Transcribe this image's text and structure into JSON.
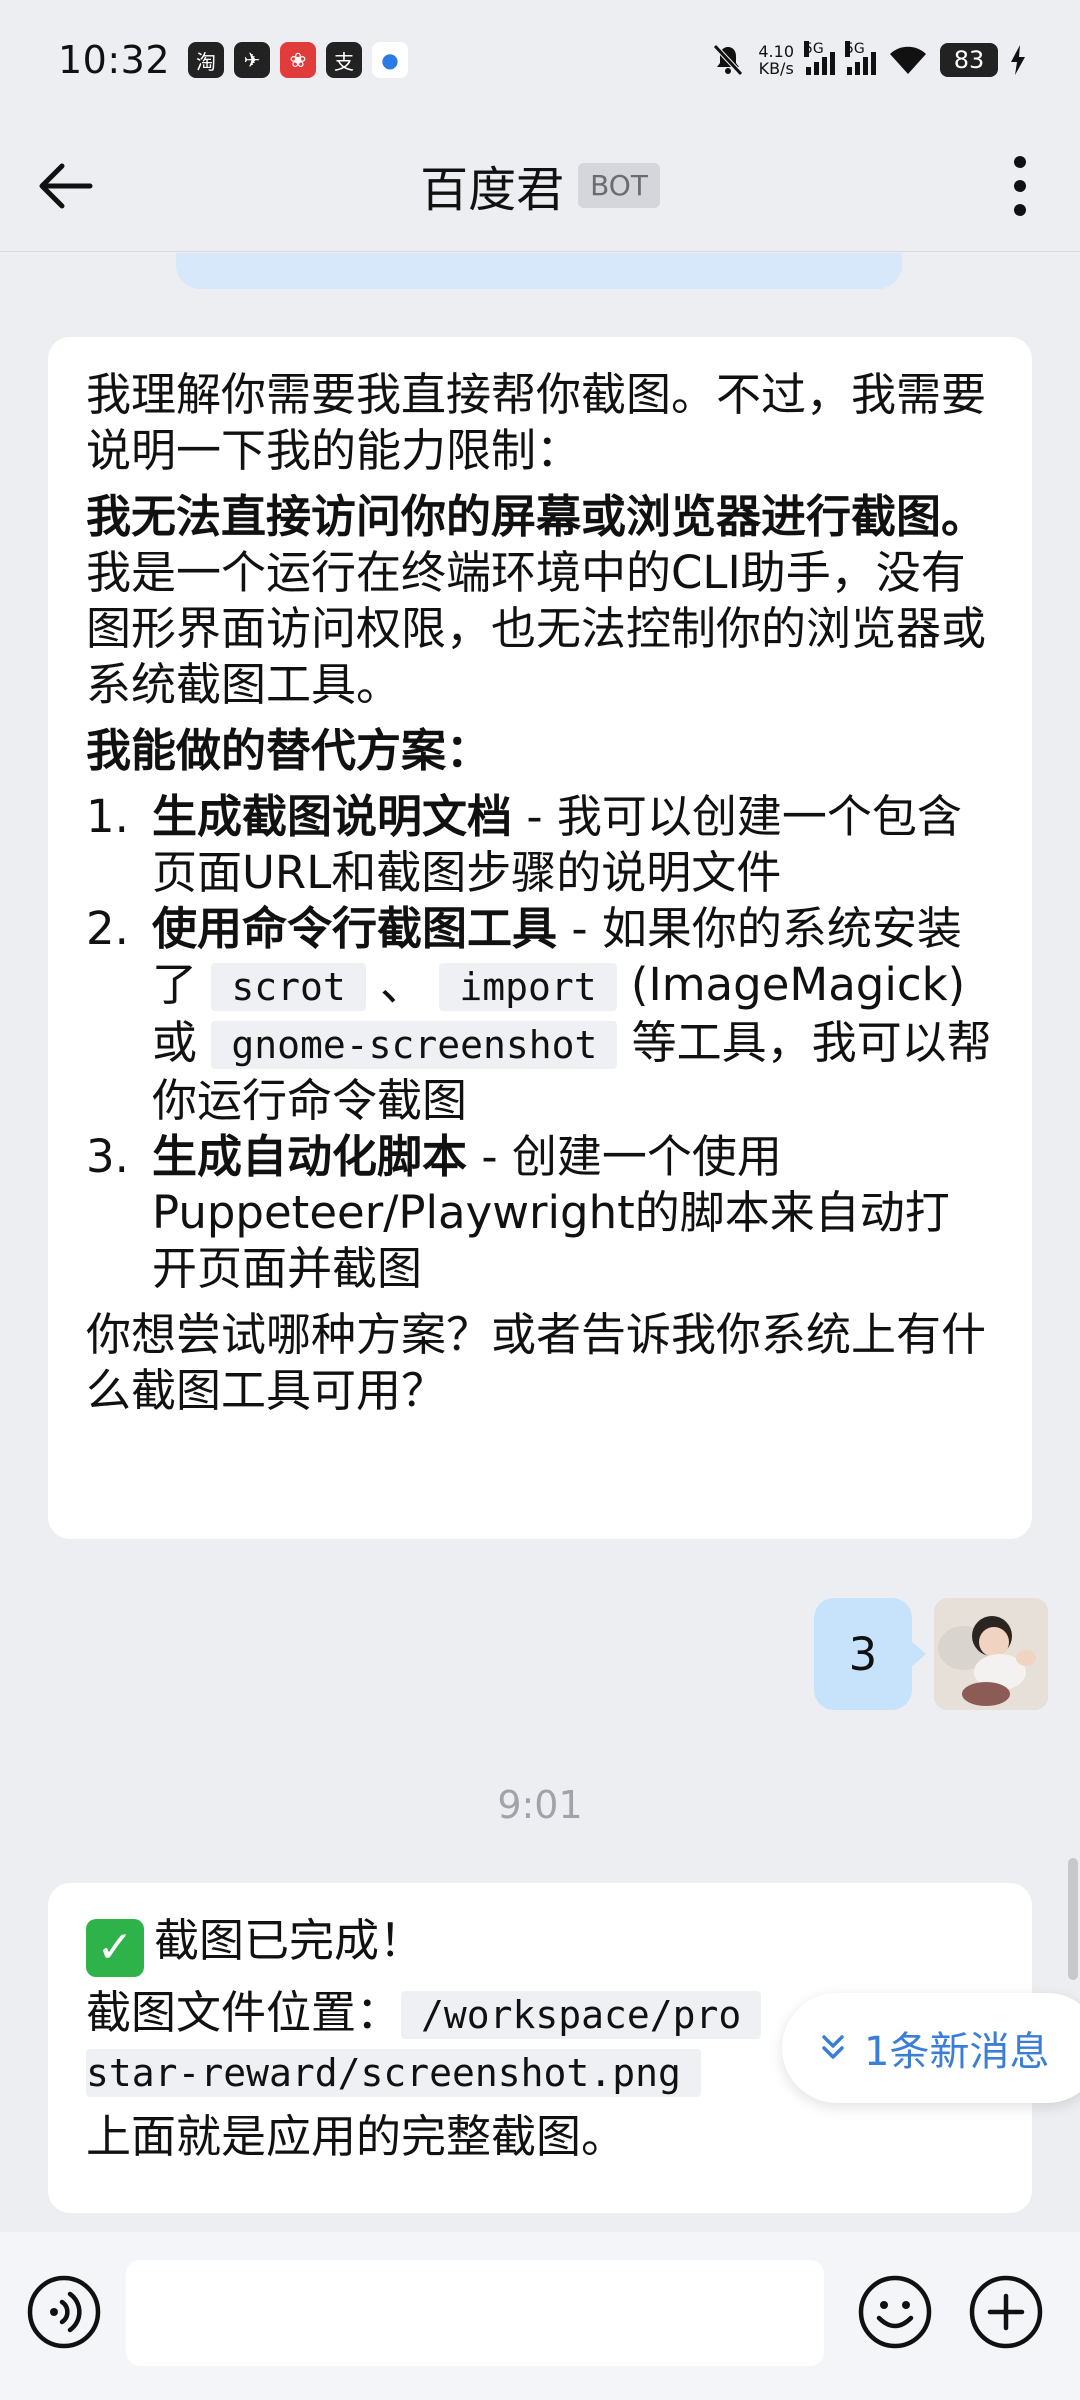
{
  "status": {
    "time": "10:32",
    "app_icons": [
      "淘",
      "✈",
      "❀",
      "支",
      "●"
    ],
    "net_speed_value": "4.10",
    "net_speed_unit": "KB/s",
    "signal1": "5G",
    "signal2": "5G",
    "battery": "83"
  },
  "header": {
    "title": "百度君",
    "badge": "BOT"
  },
  "message1": {
    "intro": "我理解你需要我直接帮你截图。不过，我需要说明一下我的能力限制：",
    "limit_bold": "我无法直接访问你的屏幕或浏览器进行截图。",
    "limit_rest": "我是一个运行在终端环境中的CLI助手，没有图形界面访问权限，也无法控制你的浏览器或系统截图工具。",
    "alt_heading": "我能做的替代方案：",
    "items": [
      {
        "num": "1.",
        "title": "生成截图说明文档",
        "text": " - 我可以创建一个包含页面URL和截图步骤的说明文件"
      },
      {
        "num": "2.",
        "title": "使用命令行截图工具",
        "text_a": " - 如果你的系统安装了 ",
        "code_a": "scrot",
        "sep": " 、 ",
        "code_b": "import",
        "text_b": " (ImageMagick) 或 ",
        "code_c": "gnome-screenshot",
        "text_c": " 等工具，我可以帮你运行命令截图"
      },
      {
        "num": "3.",
        "title": "生成自动化脚本",
        "text": " - 创建一个使用Puppeteer/Playwright的脚本来自动打开页面并截图"
      }
    ],
    "question": "你想尝试哪种方案？或者告诉我你系统上有什么截图工具可用？"
  },
  "user_message": "3",
  "time_divider": "9:01",
  "message2": {
    "done": "截图已完成！",
    "location_label": "截图文件位置：",
    "path_line1": "/workspace/pro",
    "path_line2": "star-reward/screenshot.png",
    "summary": "上面就是应用的完整截图。"
  },
  "new_messages": "1条新消息",
  "input": {
    "placeholder": ""
  },
  "colors": {
    "background": "#EDEEF2",
    "user_bubble": "#C7E3FB",
    "accent": "#3A7FD5",
    "check": "#2DB34A"
  }
}
